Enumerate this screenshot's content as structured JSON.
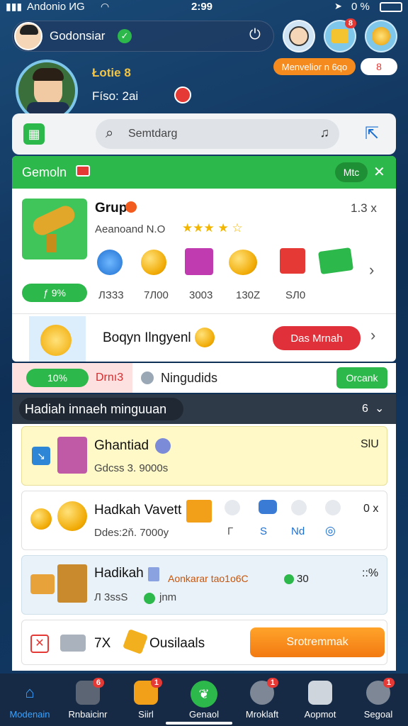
{
  "status_bar": {
    "carrier": "Andonio ИG",
    "time": "2:99",
    "battery": "0 %"
  },
  "header": {
    "username": "Godonsiar",
    "profile_label_1": "Łotie 8",
    "profile_label_2": "Físo: 2ai",
    "notification_count": "8",
    "promo_label": "Menvelior n 6qo",
    "promo_count": "8"
  },
  "search": {
    "placeholder": "Semtdarg"
  },
  "section_green": {
    "title": "Gemoln",
    "tag": "Mtc"
  },
  "group_card": {
    "title": "Grup",
    "subtitle": "Aeanoand N.O",
    "count": "1.3 x",
    "percent": "ƒ 9%",
    "rewards": [
      {
        "name": "coin-stack-icon",
        "value": "ЛЗ33"
      },
      {
        "name": "coins-icon",
        "value": "7Л00"
      },
      {
        "name": "gift-box-icon",
        "value": "3003"
      },
      {
        "name": "gold-coins-icon",
        "value": "130Z"
      },
      {
        "name": "red-gift-icon",
        "value": "ЅЛ0"
      },
      {
        "name": "cash-icon",
        "value": ""
      }
    ]
  },
  "bonus_row": {
    "label": "Boqyn Ilngyenl",
    "button": "Das Mrnah"
  },
  "progress_row": {
    "percent": "10%",
    "label_red": "Drnı3",
    "label": "Ningudids",
    "button": "Orcank"
  },
  "weekly": {
    "title": "Hadiah innaeh minguuan",
    "count": "6"
  },
  "items": [
    {
      "title": "Ghantiad",
      "sub": "Gdcss 3. 9000s",
      "right": "SlU"
    },
    {
      "title": "Hadkah Vavett",
      "sub": "Ddes:2ň. 7000y",
      "right": "0 x",
      "icons": [
        "Г",
        "S",
        "Nd",
        "◎"
      ]
    },
    {
      "title": "Hadikah",
      "sub": "Л 3ssS",
      "extra": "Aonkarar tao1o6C",
      "extra2": "30",
      "sub2": "jnm",
      "right": "::%"
    }
  ],
  "footer_card": {
    "count": "7X",
    "label": "Ousilaals",
    "button": "Srotremmak"
  },
  "tabs": [
    {
      "label": "Modenain",
      "icon": "home-icon",
      "badge": ""
    },
    {
      "label": "Rnbaicinr",
      "icon": "shop-icon",
      "badge": "6"
    },
    {
      "label": "Siirl",
      "icon": "mail-icon",
      "badge": "1"
    },
    {
      "label": "Genaol",
      "icon": "leaf-icon",
      "badge": ""
    },
    {
      "label": "Mroklaft",
      "icon": "chat-icon",
      "badge": "1"
    },
    {
      "label": "Aopmot",
      "icon": "calendar-icon",
      "badge": ""
    },
    {
      "label": "Segoal",
      "icon": "profile-icon",
      "badge": "1"
    }
  ],
  "colors": {
    "green": "#2db84b",
    "orange": "#f58a1f",
    "red": "#e53935",
    "navy": "#1a4a78"
  }
}
